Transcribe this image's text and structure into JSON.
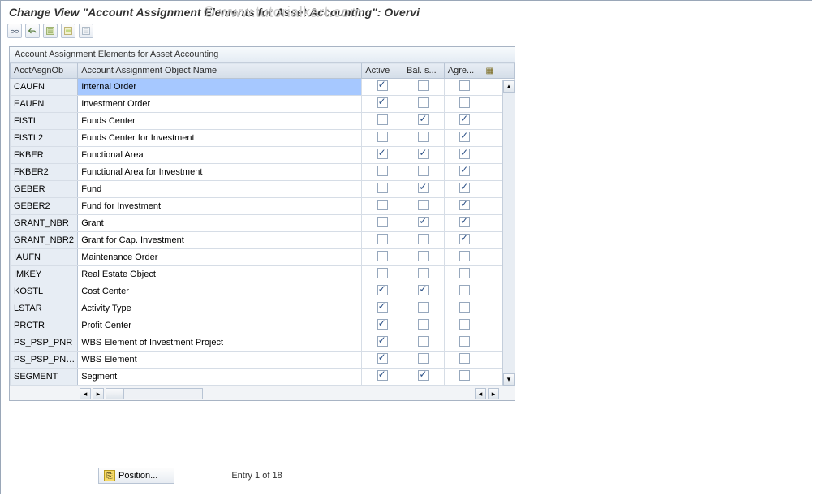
{
  "title": "Change View \"Account Assignment Elements for Asset Accounting\": Overvi",
  "watermark": "© www.tutorialkart.com",
  "panel": {
    "heading": "Account Assignment Elements for Asset Accounting"
  },
  "columns": {
    "key": "AcctAsgnOb",
    "name": "Account Assignment Object Name",
    "active": "Active",
    "bals": "Bal. s...",
    "agre": "Agre..."
  },
  "rows": [
    {
      "key": "CAUFN",
      "name": "Internal Order",
      "active": true,
      "bals": false,
      "agre": false,
      "selected": true
    },
    {
      "key": "EAUFN",
      "name": "Investment Order",
      "active": true,
      "bals": false,
      "agre": false
    },
    {
      "key": "FISTL",
      "name": "Funds Center",
      "active": false,
      "bals": true,
      "agre": true
    },
    {
      "key": "FISTL2",
      "name": "Funds Center for Investment",
      "active": false,
      "bals": false,
      "agre": true
    },
    {
      "key": "FKBER",
      "name": "Functional Area",
      "active": true,
      "bals": true,
      "agre": true
    },
    {
      "key": "FKBER2",
      "name": "Functional Area for Investment",
      "active": false,
      "bals": false,
      "agre": true
    },
    {
      "key": "GEBER",
      "name": "Fund",
      "active": false,
      "bals": true,
      "agre": true
    },
    {
      "key": "GEBER2",
      "name": "Fund for Investment",
      "active": false,
      "bals": false,
      "agre": true
    },
    {
      "key": "GRANT_NBR",
      "name": "Grant",
      "active": false,
      "bals": true,
      "agre": true
    },
    {
      "key": "GRANT_NBR2",
      "name": "Grant for Cap. Investment",
      "active": false,
      "bals": false,
      "agre": true
    },
    {
      "key": "IAUFN",
      "name": "Maintenance Order",
      "active": false,
      "bals": false,
      "agre": false
    },
    {
      "key": "IMKEY",
      "name": "Real Estate Object",
      "active": false,
      "bals": false,
      "agre": false
    },
    {
      "key": "KOSTL",
      "name": "Cost Center",
      "active": true,
      "bals": true,
      "agre": false
    },
    {
      "key": "LSTAR",
      "name": "Activity Type",
      "active": true,
      "bals": false,
      "agre": false
    },
    {
      "key": "PRCTR",
      "name": "Profit Center",
      "active": true,
      "bals": false,
      "agre": false
    },
    {
      "key": "PS_PSP_PNR",
      "name": "WBS Element of Investment Project",
      "active": true,
      "bals": false,
      "agre": false
    },
    {
      "key": "PS_PSP_PN…",
      "name": "WBS Element",
      "active": true,
      "bals": false,
      "agre": false
    },
    {
      "key": "SEGMENT",
      "name": "Segment",
      "active": true,
      "bals": true,
      "agre": false
    }
  ],
  "footer": {
    "position_button": "Position...",
    "entry_text": "Entry 1 of 18"
  }
}
